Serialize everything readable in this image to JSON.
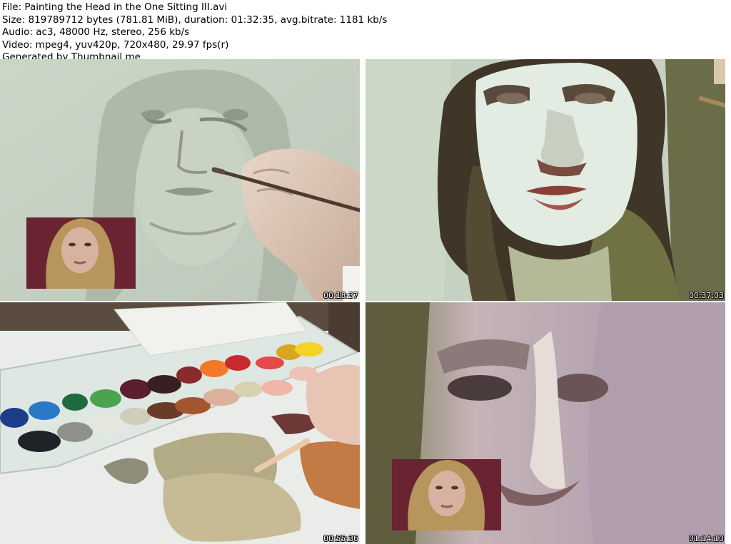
{
  "header": {
    "file_line": "File: Painting the Head in the One Sitting III.avi",
    "size_line": "Size: 819789712 bytes (781.81 MiB), duration: 01:32:35, avg.bitrate: 1181 kb/s",
    "audio_line": "Audio: ac3, 48000 Hz, stereo, 256 kb/s",
    "video_line": "Video: mpeg4, yuv420p, 720x480, 29.97 fps(r)",
    "generator_line": "Generated by Thumbnail me"
  },
  "thumbnails": [
    {
      "timestamp": "00:18:37",
      "scene": "underdrawing-with-brush"
    },
    {
      "timestamp": "00:37:03",
      "scene": "blocked-in-portrait"
    },
    {
      "timestamp": "00:55:36",
      "scene": "paint-palette"
    },
    {
      "timestamp": "01:14:10",
      "scene": "closeup-with-reference"
    }
  ],
  "colors": {
    "canvas_green": "#c5d2c2",
    "sketch_gray": "#8f988a",
    "hair_dark": "#3f3628",
    "lip_red": "#8a3f36",
    "reference_bg": "#6a2431",
    "timestamp_text": "#ffffff"
  }
}
